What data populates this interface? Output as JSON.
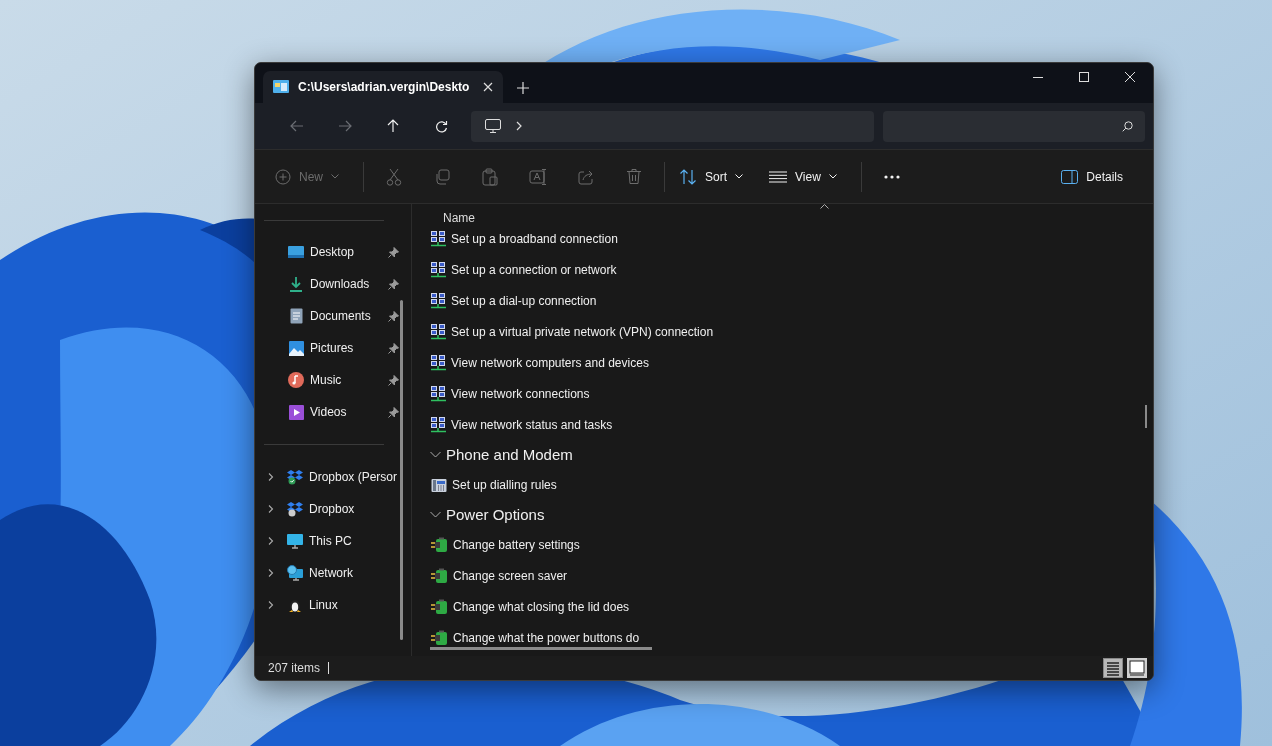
{
  "tab": {
    "title": "C:\\Users\\adrian.vergin\\Deskto",
    "selected": true
  },
  "toolbar": [
    {
      "kind": "new",
      "label": "New",
      "disabled": true
    },
    {
      "kind": "cut",
      "disabled": true
    },
    {
      "kind": "copy",
      "disabled": true
    },
    {
      "kind": "paste",
      "disabled": true
    },
    {
      "kind": "rename",
      "disabled": true
    },
    {
      "kind": "share",
      "disabled": true
    },
    {
      "kind": "delete",
      "disabled": true
    },
    {
      "kind": "sort",
      "label": "Sort",
      "disabled": false
    },
    {
      "kind": "view",
      "label": "View",
      "disabled": false
    },
    {
      "kind": "more",
      "disabled": false
    },
    {
      "kind": "details",
      "label": "Details",
      "disabled": false
    }
  ],
  "sidebar": {
    "pinned": [
      {
        "kind": "desktop",
        "label": "Desktop",
        "pinned": true
      },
      {
        "kind": "downloads",
        "label": "Downloads",
        "pinned": true
      },
      {
        "kind": "documents",
        "label": "Documents",
        "pinned": true
      },
      {
        "kind": "pictures",
        "label": "Pictures",
        "pinned": true
      },
      {
        "kind": "music",
        "label": "Music",
        "pinned": true
      },
      {
        "kind": "videos",
        "label": "Videos",
        "pinned": true
      }
    ],
    "tree": [
      {
        "kind": "dropbox-synced",
        "label": "Dropbox (Persor",
        "expanded": false
      },
      {
        "kind": "dropbox",
        "label": "Dropbox",
        "expanded": false
      },
      {
        "kind": "pc",
        "label": "This PC",
        "expanded": false
      },
      {
        "kind": "network",
        "label": "Network",
        "expanded": false
      },
      {
        "kind": "linux",
        "label": "Linux",
        "expanded": false
      }
    ]
  },
  "list": {
    "column": "Name",
    "groups": [
      {
        "items": [
          {
            "kind": "network",
            "label": "Set up a broadband connection"
          },
          {
            "kind": "network",
            "label": "Set up a connection or network"
          },
          {
            "kind": "network",
            "label": "Set up a dial-up connection"
          },
          {
            "kind": "network",
            "label": "Set up a virtual private network (VPN) connection"
          },
          {
            "kind": "network",
            "label": "View network computers and devices"
          },
          {
            "kind": "network",
            "label": "View network connections"
          },
          {
            "kind": "network",
            "label": "View network status and tasks"
          }
        ]
      },
      {
        "title": "Phone and Modem",
        "expanded": true,
        "items": [
          {
            "kind": "phone",
            "label": "Set up dialling rules"
          }
        ]
      },
      {
        "title": "Power Options",
        "expanded": true,
        "items": [
          {
            "kind": "power",
            "label": "Change battery settings"
          },
          {
            "kind": "power",
            "label": "Change screen saver"
          },
          {
            "kind": "power",
            "label": "Change what closing the lid does"
          },
          {
            "kind": "power",
            "label": "Change what the power buttons do"
          }
        ]
      }
    ]
  },
  "status": {
    "count": "207 items",
    "views": [
      {
        "kind": "details",
        "selected": true
      },
      {
        "kind": "tiles",
        "selected": false
      }
    ]
  }
}
